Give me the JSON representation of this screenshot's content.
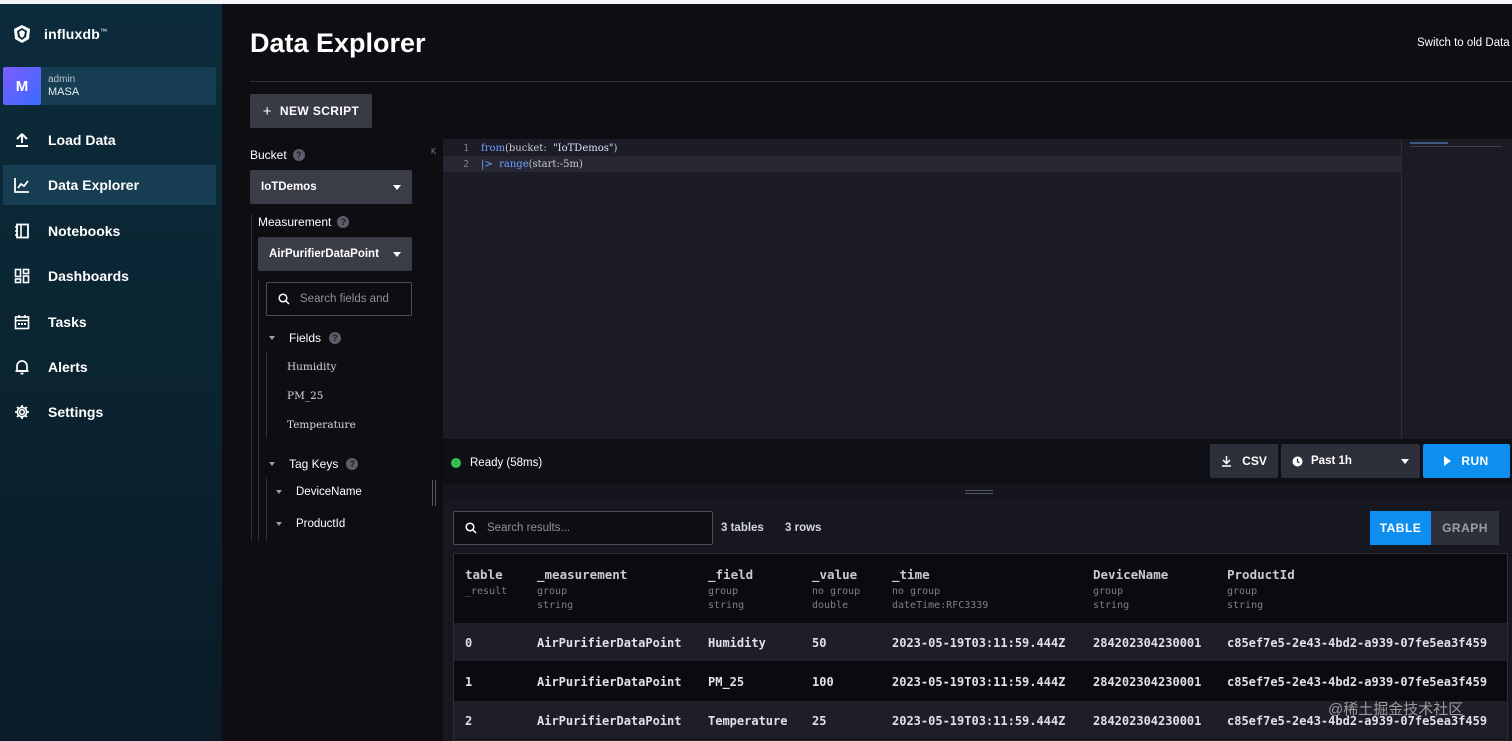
{
  "app": {
    "brand": "influxdb",
    "page_title": "Data Explorer",
    "switch_link": "Switch to old Data Explorer"
  },
  "user": {
    "initial": "M",
    "role": "admin",
    "org": "MASA"
  },
  "nav": [
    {
      "label": "Load Data",
      "icon": "upload-icon"
    },
    {
      "label": "Data Explorer",
      "icon": "graph-icon",
      "active": true
    },
    {
      "label": "Notebooks",
      "icon": "notebook-icon"
    },
    {
      "label": "Dashboards",
      "icon": "dashboards-icon"
    },
    {
      "label": "Tasks",
      "icon": "calendar-icon"
    },
    {
      "label": "Alerts",
      "icon": "bell-icon"
    },
    {
      "label": "Settings",
      "icon": "gear-icon"
    }
  ],
  "toolbar": {
    "new_script": "NEW SCRIPT"
  },
  "schema": {
    "bucket_label": "Bucket",
    "bucket_value": "IoTDemos",
    "measurement_label": "Measurement",
    "measurement_value": "AirPurifierDataPoint",
    "search_placeholder": "Search fields and",
    "fields_label": "Fields",
    "fields": [
      "Humidity",
      "PM_25",
      "Temperature"
    ],
    "tagkeys_label": "Tag Keys",
    "tag_keys": [
      "DeviceName",
      "ProductId"
    ]
  },
  "editor": {
    "lines": [
      {
        "num": "1",
        "fn": "from",
        "rest_a": "(bucket:  ",
        "str": "\"IoTDemos\"",
        "rest_b": ")"
      },
      {
        "num": "2",
        "fn": "range",
        "rest_a": "(start:-5m)",
        "str": "",
        "rest_b": "",
        "pipe": "|>  "
      }
    ]
  },
  "status": {
    "text": "Ready (58ms)",
    "color": "#33c04a"
  },
  "actions": {
    "csv": "CSV",
    "range": "Past 1h",
    "run": "RUN"
  },
  "results": {
    "search_placeholder": "Search results...",
    "tables_count": "3 tables",
    "rows_count": "3 rows",
    "view_table": "TABLE",
    "view_graph": "GRAPH",
    "columns": [
      {
        "name": "table",
        "sub1": "_result",
        "sub2": ""
      },
      {
        "name": "_measurement",
        "sub1": "group",
        "sub2": "string"
      },
      {
        "name": "_field",
        "sub1": "group",
        "sub2": "string"
      },
      {
        "name": "_value",
        "sub1": "no group",
        "sub2": "double"
      },
      {
        "name": "_time",
        "sub1": "no group",
        "sub2": "dateTime:RFC3339"
      },
      {
        "name": "DeviceName",
        "sub1": "group",
        "sub2": "string"
      },
      {
        "name": "ProductId",
        "sub1": "group",
        "sub2": "string"
      }
    ],
    "rows": [
      [
        "0",
        "AirPurifierDataPoint",
        "Humidity",
        "50",
        "2023-05-19T03:11:59.444Z",
        "284202304230001",
        "c85ef7e5-2e43-4bd2-a939-07fe5ea3f459"
      ],
      [
        "1",
        "AirPurifierDataPoint",
        "PM_25",
        "100",
        "2023-05-19T03:11:59.444Z",
        "284202304230001",
        "c85ef7e5-2e43-4bd2-a939-07fe5ea3f459"
      ],
      [
        "2",
        "AirPurifierDataPoint",
        "Temperature",
        "25",
        "2023-05-19T03:11:59.444Z",
        "284202304230001",
        "c85ef7e5-2e43-4bd2-a939-07fe5ea3f459"
      ]
    ]
  },
  "watermark": "@稀土掘金技术社区"
}
